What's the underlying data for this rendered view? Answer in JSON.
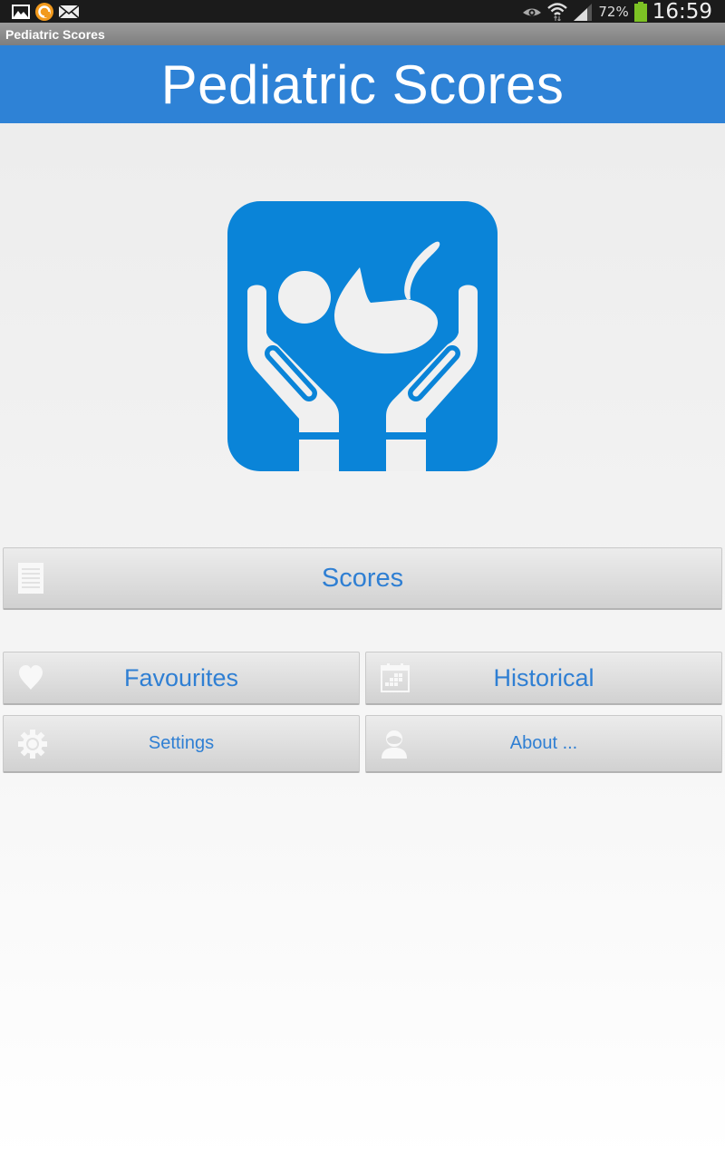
{
  "status_bar": {
    "notifications": [
      "gallery-icon",
      "sync-app-icon",
      "mail-icon"
    ],
    "system_icons": [
      "eye-icon",
      "wifi-icon",
      "signal-icon"
    ],
    "battery_percent": "72%",
    "battery_level": 0.72,
    "time": "16:59"
  },
  "window": {
    "title": "Pediatric Scores"
  },
  "header": {
    "title": "Pediatric Scores",
    "background_color": "#2e82d6"
  },
  "logo": {
    "description": "hands-holding-baby-logo",
    "color": "#0a84d8"
  },
  "menu": {
    "scores": {
      "label": "Scores",
      "icon": "document-icon"
    },
    "favourites": {
      "label": "Favourites",
      "icon": "heart-icon"
    },
    "historical": {
      "label": "Historical",
      "icon": "calendar-icon"
    },
    "settings": {
      "label": "Settings",
      "icon": "gear-icon"
    },
    "about": {
      "label": "About ...",
      "icon": "person-icon"
    },
    "text_color": "#2f7fd3"
  }
}
